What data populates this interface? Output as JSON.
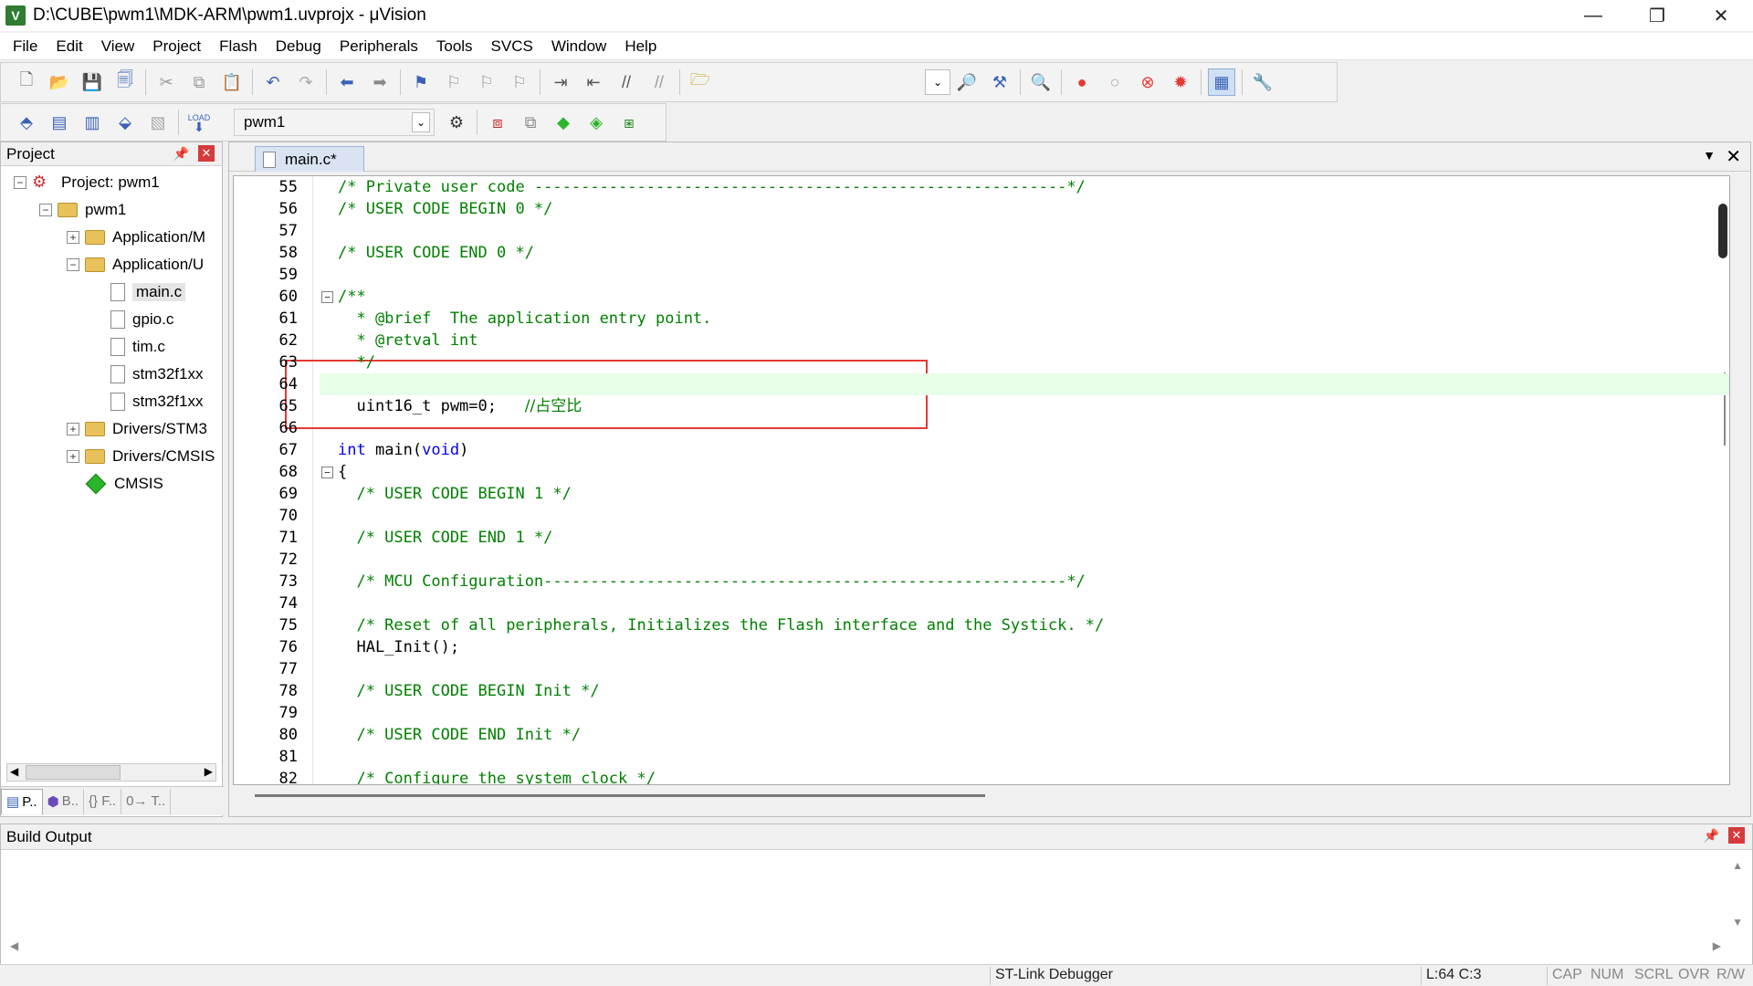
{
  "window": {
    "title": "D:\\CUBE\\pwm1\\MDK-ARM\\pwm1.uvprojx - μVision",
    "app_icon_letter": "V",
    "minimize": "—",
    "restore": "❐",
    "close": "✕"
  },
  "menu": [
    "File",
    "Edit",
    "View",
    "Project",
    "Flash",
    "Debug",
    "Peripherals",
    "Tools",
    "SVCS",
    "Window",
    "Help"
  ],
  "toolbar2": {
    "target_name": "pwm1",
    "load_label": "LOAD"
  },
  "project_panel": {
    "title": "Project",
    "pin": "📌",
    "close": "✕",
    "tree": [
      {
        "label": "Project: pwm1",
        "level": 0,
        "expander": "−",
        "icon": "project-icon"
      },
      {
        "label": "pwm1",
        "level": 1,
        "expander": "−",
        "icon": "folder-icon"
      },
      {
        "label": "Application/M",
        "level": 2,
        "expander": "+",
        "icon": "folder-icon"
      },
      {
        "label": "Application/U",
        "level": 2,
        "expander": "−",
        "icon": "folder-icon"
      },
      {
        "label": "main.c",
        "level": 3,
        "expander": "",
        "icon": "file-icon",
        "selected": true
      },
      {
        "label": "gpio.c",
        "level": 3,
        "expander": "",
        "icon": "file-icon"
      },
      {
        "label": "tim.c",
        "level": 3,
        "expander": "",
        "icon": "file-icon"
      },
      {
        "label": "stm32f1xx",
        "level": 3,
        "expander": "",
        "icon": "file-icon"
      },
      {
        "label": "stm32f1xx",
        "level": 3,
        "expander": "",
        "icon": "file-icon"
      },
      {
        "label": "Drivers/STM3",
        "level": 2,
        "expander": "+",
        "icon": "folder-icon"
      },
      {
        "label": "Drivers/CMSIS",
        "level": 2,
        "expander": "+",
        "icon": "folder-icon"
      },
      {
        "label": "CMSIS",
        "level": 2,
        "expander": "",
        "icon": "cmsis-diamond-icon"
      }
    ],
    "tabs": [
      "P..",
      "B..",
      "{} F..",
      "0→ T.."
    ]
  },
  "editor": {
    "tab_label": "main.c*",
    "menu_glyph": "▼",
    "close_glyph": "✕",
    "lines": [
      {
        "n": "55",
        "parts": [
          {
            "t": "/* Private user code ---------------------------------------------------------*/",
            "c": "comment"
          }
        ]
      },
      {
        "n": "56",
        "parts": [
          {
            "t": "/* USER CODE BEGIN 0 */",
            "c": "comment"
          }
        ]
      },
      {
        "n": "57",
        "parts": []
      },
      {
        "n": "58",
        "parts": [
          {
            "t": "/* USER CODE END 0 */",
            "c": "comment"
          }
        ]
      },
      {
        "n": "59",
        "parts": []
      },
      {
        "n": "60",
        "fold": "−",
        "parts": [
          {
            "t": "/**",
            "c": "comment"
          }
        ]
      },
      {
        "n": "61",
        "parts": [
          {
            "t": "  * @brief  The application entry point.",
            "c": "comment"
          }
        ]
      },
      {
        "n": "62",
        "parts": [
          {
            "t": "  * @retval int",
            "c": "comment"
          }
        ]
      },
      {
        "n": "63",
        "parts": [
          {
            "t": "  */",
            "c": "comment"
          }
        ]
      },
      {
        "n": "64",
        "highlight": true,
        "parts": []
      },
      {
        "n": "65",
        "parts": [
          {
            "t": "  uint16_t pwm=",
            "c": "plain"
          },
          {
            "t": "0",
            "c": "num"
          },
          {
            "t": ";   ",
            "c": "plain"
          },
          {
            "t": "//占空比",
            "c": "cn"
          }
        ]
      },
      {
        "n": "66",
        "parts": []
      },
      {
        "n": "67",
        "parts": [
          {
            "t": "int",
            "c": "kw"
          },
          {
            "t": " main(",
            "c": "plain"
          },
          {
            "t": "void",
            "c": "kw"
          },
          {
            "t": ")",
            "c": "plain"
          }
        ]
      },
      {
        "n": "68",
        "fold": "−",
        "parts": [
          {
            "t": "{",
            "c": "plain"
          }
        ]
      },
      {
        "n": "69",
        "parts": [
          {
            "t": "  /* USER CODE BEGIN 1 */",
            "c": "comment"
          }
        ]
      },
      {
        "n": "70",
        "parts": []
      },
      {
        "n": "71",
        "parts": [
          {
            "t": "  /* USER CODE END 1 */",
            "c": "comment"
          }
        ]
      },
      {
        "n": "72",
        "parts": []
      },
      {
        "n": "73",
        "parts": [
          {
            "t": "  /* MCU Configuration--------------------------------------------------------*/",
            "c": "comment"
          }
        ]
      },
      {
        "n": "74",
        "parts": []
      },
      {
        "n": "75",
        "parts": [
          {
            "t": "  /* Reset of all peripherals, Initializes the Flash interface and the Systick. */",
            "c": "comment"
          }
        ]
      },
      {
        "n": "76",
        "parts": [
          {
            "t": "  HAL_Init();",
            "c": "plain"
          }
        ]
      },
      {
        "n": "77",
        "parts": []
      },
      {
        "n": "78",
        "parts": [
          {
            "t": "  /* USER CODE BEGIN Init */",
            "c": "comment"
          }
        ]
      },
      {
        "n": "79",
        "parts": []
      },
      {
        "n": "80",
        "parts": [
          {
            "t": "  /* USER CODE END Init */",
            "c": "comment"
          }
        ]
      },
      {
        "n": "81",
        "parts": []
      },
      {
        "n": "82",
        "parts": [
          {
            "t": "  /* Configure the system clock */",
            "c": "comment"
          }
        ]
      }
    ]
  },
  "build_output": {
    "title": "Build Output",
    "pin": "📌",
    "close": "✕"
  },
  "status": {
    "debugger": "ST-Link Debugger",
    "cursor": "L:64 C:3",
    "cap": "CAP",
    "num": "NUM",
    "scrl": "SCRL",
    "ovr": "OVR",
    "rw": "R/W"
  },
  "colors": {
    "comment": "#008000",
    "keyword": "#0000ff",
    "annotation_box": "#e53935",
    "current_line": "#e6ffe6"
  }
}
